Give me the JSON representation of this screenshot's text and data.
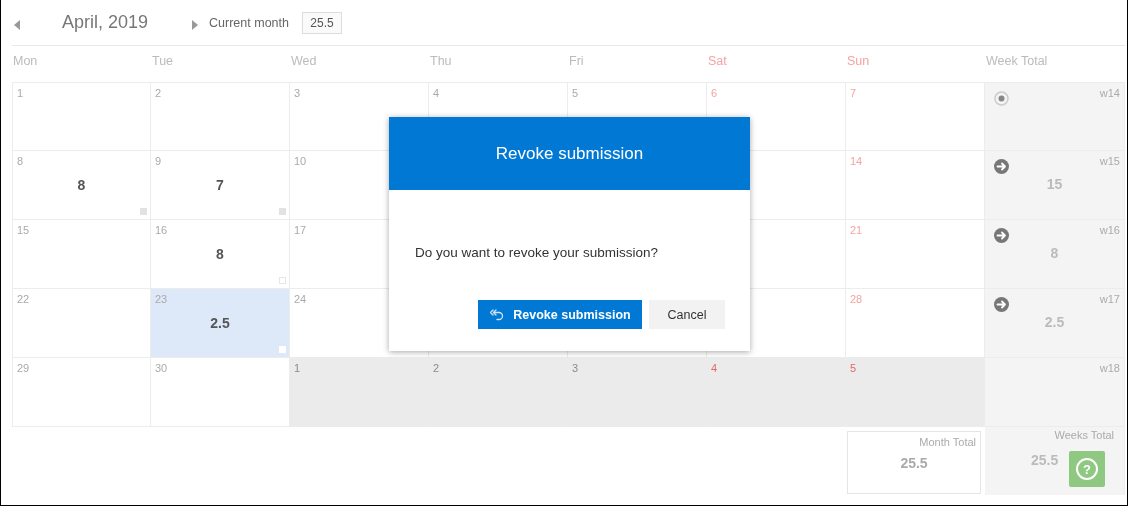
{
  "header": {
    "month": "April, 2019",
    "current_label": "Current month",
    "current_value": "25.5"
  },
  "weekdays": [
    {
      "label": "Mon",
      "weekend": false
    },
    {
      "label": "Tue",
      "weekend": false
    },
    {
      "label": "Wed",
      "weekend": false
    },
    {
      "label": "Thu",
      "weekend": false
    },
    {
      "label": "Fri",
      "weekend": false
    },
    {
      "label": "Sat",
      "weekend": true
    },
    {
      "label": "Sun",
      "weekend": true
    }
  ],
  "week_total_heading": "Week Total",
  "weeks": [
    {
      "week": "w14",
      "icon": {
        "kind": "radio"
      },
      "days": [
        {
          "kind": "day",
          "day": "1",
          "in_month": true,
          "selected": false
        },
        {
          "kind": "day",
          "day": "2",
          "in_month": true,
          "selected": false
        },
        {
          "kind": "day",
          "day": "3",
          "in_month": true,
          "selected": false
        },
        {
          "kind": "day",
          "day": "4",
          "in_month": true,
          "selected": false
        },
        {
          "kind": "day",
          "day": "5",
          "in_month": true,
          "selected": false
        },
        {
          "kind": "day",
          "day": "6",
          "in_month": true,
          "selected": false
        },
        {
          "kind": "day",
          "day": "7",
          "in_month": true,
          "selected": false
        }
      ]
    },
    {
      "week": "w15",
      "icon": {
        "kind": "arrow"
      },
      "total": "15",
      "days": [
        {
          "kind": "day",
          "day": "8",
          "hours": "8",
          "marker": {
            "kind": "filled"
          },
          "in_month": true,
          "selected": false
        },
        {
          "kind": "day",
          "day": "9",
          "hours": "7",
          "marker": {
            "kind": "filled"
          },
          "in_month": true,
          "selected": false
        },
        {
          "kind": "day",
          "day": "10",
          "in_month": true,
          "selected": false
        },
        {
          "kind": "hidden"
        },
        {
          "kind": "hidden"
        },
        {
          "kind": "covered"
        },
        {
          "kind": "day",
          "day": "14",
          "in_month": true,
          "selected": false
        }
      ]
    },
    {
      "week": "w16",
      "icon": {
        "kind": "arrow"
      },
      "total": "8",
      "days": [
        {
          "kind": "day",
          "day": "15",
          "in_month": true,
          "selected": false
        },
        {
          "kind": "day",
          "day": "16",
          "hours": "8",
          "marker": {
            "kind": "outline"
          },
          "in_month": true,
          "selected": false
        },
        {
          "kind": "day",
          "day": "17",
          "in_month": true,
          "selected": false
        },
        {
          "kind": "hidden"
        },
        {
          "kind": "hidden"
        },
        {
          "kind": "covered"
        },
        {
          "kind": "day",
          "day": "21",
          "in_month": true,
          "selected": false
        }
      ]
    },
    {
      "week": "w17",
      "icon": {
        "kind": "arrow"
      },
      "total": "2.5",
      "days": [
        {
          "kind": "day",
          "day": "22",
          "in_month": true,
          "selected": false
        },
        {
          "kind": "day",
          "day": "23",
          "hours": "2.5",
          "marker": {
            "kind": "faint"
          },
          "in_month": true,
          "selected": true
        },
        {
          "kind": "day",
          "day": "24",
          "in_month": true,
          "selected": false
        },
        {
          "kind": "covered"
        },
        {
          "kind": "covered"
        },
        {
          "kind": "covered"
        },
        {
          "kind": "day",
          "day": "28",
          "in_month": true,
          "selected": false
        }
      ]
    },
    {
      "week": "w18",
      "days": [
        {
          "kind": "day",
          "day": "29",
          "in_month": true,
          "selected": false
        },
        {
          "kind": "day",
          "day": "30",
          "in_month": true,
          "selected": false
        },
        {
          "kind": "day",
          "day": "1",
          "in_month": false,
          "selected": false
        },
        {
          "kind": "day",
          "day": "2",
          "in_month": false,
          "selected": false
        },
        {
          "kind": "day",
          "day": "3",
          "in_month": false,
          "selected": false
        },
        {
          "kind": "day",
          "day": "4",
          "in_month": false,
          "selected": false
        },
        {
          "kind": "day",
          "day": "5",
          "in_month": false,
          "selected": false
        }
      ]
    }
  ],
  "footer": {
    "month_total_label": "Month Total",
    "month_total": "25.5",
    "weeks_total_label": "Weeks Total",
    "weeks_total": "25.5"
  },
  "help_button": {
    "label": "?"
  },
  "dialog": {
    "title": "Revoke submission",
    "message": "Do you want to revoke your submission?",
    "buttons": [
      {
        "label": "Revoke submission",
        "kind": "primary"
      },
      {
        "label": "Cancel",
        "kind": "secondary"
      }
    ]
  }
}
